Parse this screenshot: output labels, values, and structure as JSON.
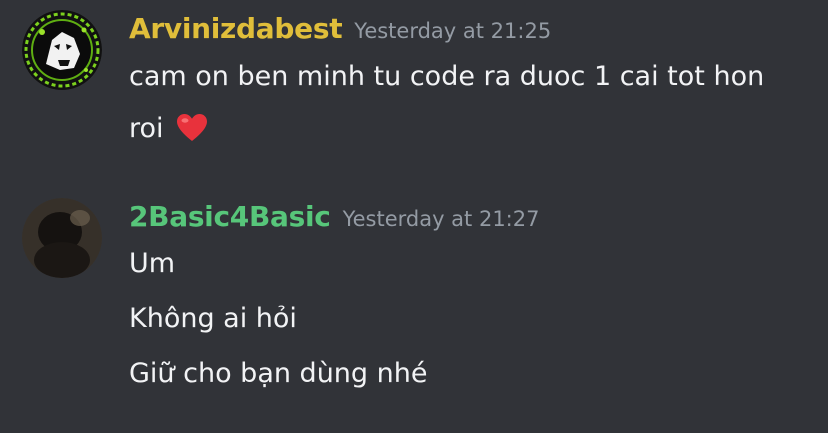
{
  "messages": [
    {
      "username": "Arvinizdabest",
      "username_color": "#e0be3a",
      "timestamp": "Yesterday at 21:25",
      "lines": [
        "cam on ben minh tu code ra duoc 1 cai tot hon",
        "roi"
      ],
      "emoji": "red-heart-icon"
    },
    {
      "username": "2Basic4Basic",
      "username_color": "#57c67a",
      "timestamp": "Yesterday at 21:27",
      "lines": [
        "Um",
        "Không ai hỏi",
        "Giữ cho bạn dùng nhé"
      ]
    }
  ],
  "colors": {
    "background": "#313338",
    "text": "#f2f3f5",
    "timestamp": "#949ba4"
  }
}
